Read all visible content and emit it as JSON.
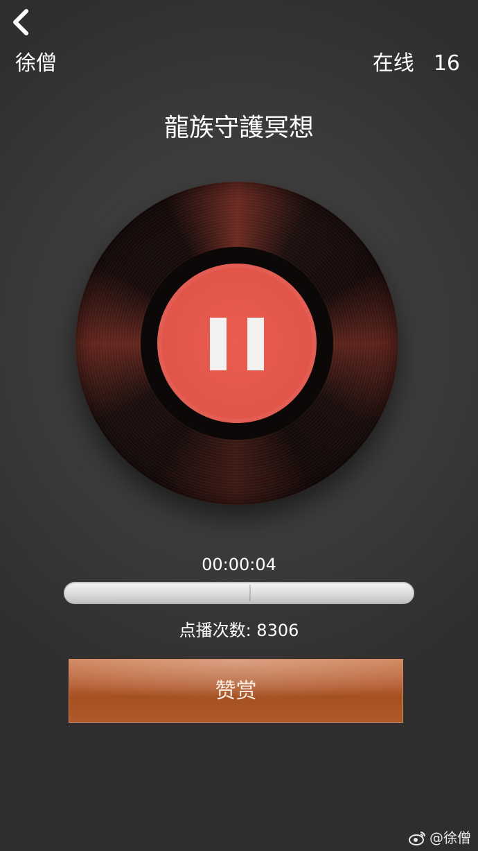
{
  "header": {
    "username": "徐僧",
    "online_label": "在线",
    "online_count": "16"
  },
  "player": {
    "title": "龍族守護冥想",
    "elapsed_time": "00:00:04",
    "progress_fraction": 0.53,
    "play_count_label": "点播次数: 8306",
    "state": "playing",
    "reward_label": "赞赏"
  },
  "watermark": {
    "text": "@徐僧"
  },
  "icons": {
    "back": "chevron-left-icon",
    "pause": "pause-icon",
    "watermark_logo": "weibo-icon"
  },
  "colors": {
    "play_button": "#e1554a",
    "reward_button": "#b0592a",
    "background": "#2f2d2d"
  }
}
